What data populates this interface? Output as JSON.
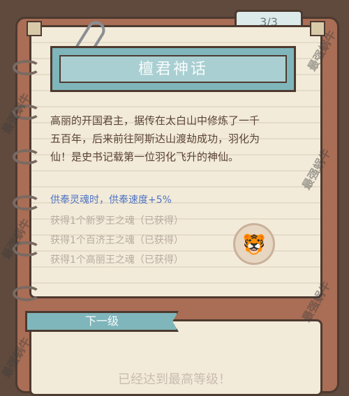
{
  "page_indicator": "3/3",
  "title": "檀君神话",
  "description": [
    "高丽的开国君主，据传在太白山中修炼了一千",
    "五百年，后来前往阿斯达山渡劫成功，羽化为",
    "仙！是史书记载第一位羽化飞升的神仙。"
  ],
  "bonus": "供奉灵魂时，供奉速度+5%",
  "requirements": [
    "获得1个新罗王之魂（已获得）",
    "获得1个百济王之魂（已获得）",
    "获得1个高丽王之魂（已获得）"
  ],
  "next_level_tab": "下一级",
  "max_level_text": "已经达到最高等级！",
  "watermarks": [
    "最强蜗牛",
    "最强蜗牛",
    "最强蜗牛",
    "最强蜗牛",
    "最强蜗牛",
    "最强蜗牛"
  ],
  "colors": {
    "frame": "#a96e55",
    "paper": "#f3ebd9",
    "teal": "#7fb6bb",
    "bonus": "#4f75c4"
  }
}
